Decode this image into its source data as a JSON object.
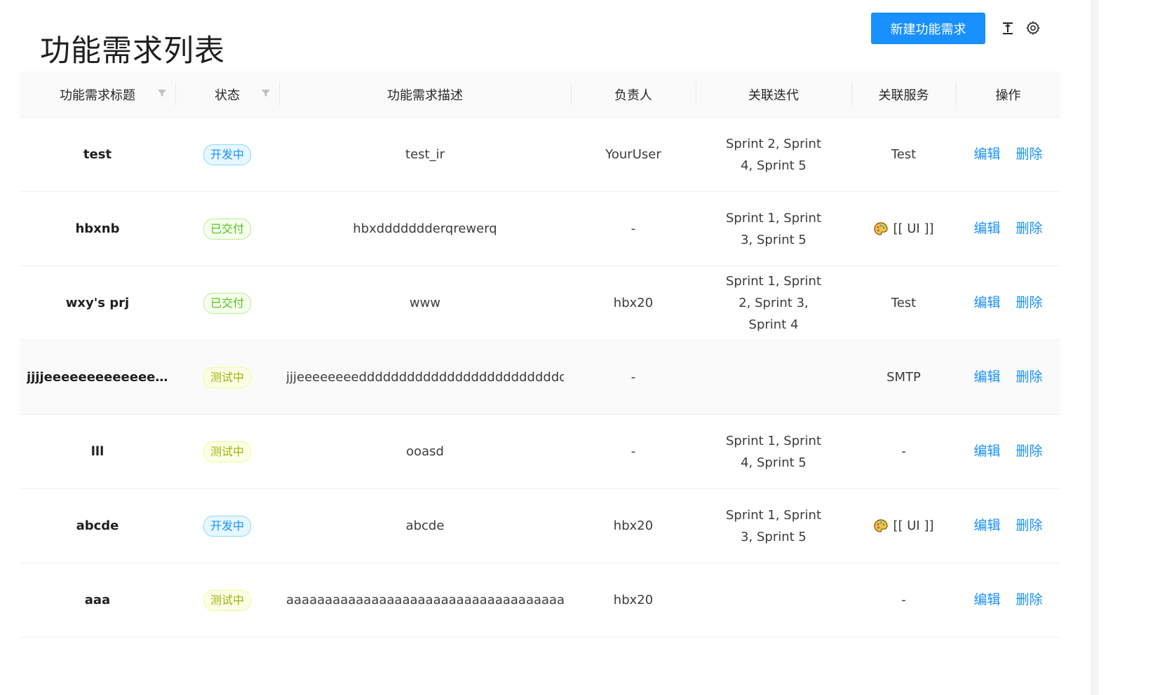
{
  "page": {
    "title": "功能需求列表",
    "new_button": "新建功能需求",
    "accent": "#1890ff"
  },
  "icons": {
    "toolbar": [
      "column-height-icon",
      "setting-icon"
    ],
    "filter": "filter-icon",
    "service": "palette-icon"
  },
  "columns": [
    "功能需求标题",
    "状态",
    "功能需求描述",
    "负责人",
    "关联迭代",
    "关联服务",
    "操作"
  ],
  "status_colors": {
    "dev": "#1890ff",
    "done": "#52c41a",
    "test": "#a0b00b"
  },
  "rows": [
    {
      "title": "test",
      "status": "开发中",
      "status_type": "dev",
      "description": "test_ir",
      "owner": "YourUser",
      "iterations": "Sprint 2, Sprint 4, Sprint 5",
      "service": "Test",
      "service_icon": false,
      "edit": "编辑",
      "delete": "删除"
    },
    {
      "title": "hbxnb",
      "status": "已交付",
      "status_type": "done",
      "description": "hbxddddddderqrewerq",
      "owner": "-",
      "iterations": "Sprint 1, Sprint 3, Sprint 5",
      "service": "[[ UI ]]",
      "service_icon": true,
      "edit": "编辑",
      "delete": "删除"
    },
    {
      "title": "wxy's prj",
      "status": "已交付",
      "status_type": "done",
      "description": "www",
      "owner": "hbx20",
      "iterations": "Sprint 1, Sprint 2, Sprint 3, Sprint 4",
      "service": "Test",
      "service_icon": false,
      "edit": "编辑",
      "delete": "删除"
    },
    {
      "title": "jjjjeeeeeeeeeeeeeee...",
      "status": "测试中",
      "status_type": "test",
      "description": "jjjeeeeeeeedddddddddddddddddddddddddddddd",
      "owner": "-",
      "iterations": "",
      "service": "SMTP",
      "service_icon": false,
      "edit": "编辑",
      "delete": "删除",
      "hover": true
    },
    {
      "title": "lll",
      "status": "测试中",
      "status_type": "test",
      "description": "ooasd",
      "owner": "-",
      "iterations": "Sprint 1, Sprint 4, Sprint 5",
      "service": "-",
      "service_icon": false,
      "edit": "编辑",
      "delete": "删除"
    },
    {
      "title": "abcde",
      "status": "开发中",
      "status_type": "dev",
      "description": "abcde",
      "owner": "hbx20",
      "iterations": "Sprint 1, Sprint 3, Sprint 5",
      "service": "[[ UI ]]",
      "service_icon": true,
      "edit": "编辑",
      "delete": "删除"
    },
    {
      "title": "aaa",
      "status": "测试中",
      "status_type": "test",
      "description": "aaaaaaaaaaaaaaaaaaaaaaaaaaaaaaaaaaaaaa",
      "owner": "hbx20",
      "iterations": "",
      "service": "-",
      "service_icon": false,
      "edit": "编辑",
      "delete": "删除"
    }
  ]
}
